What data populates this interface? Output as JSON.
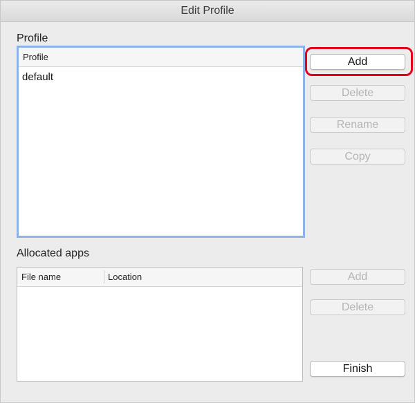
{
  "window": {
    "title": "Edit Profile"
  },
  "profile_section": {
    "label": "Profile",
    "column_header": "Profile",
    "rows": [
      "default"
    ]
  },
  "profile_buttons": {
    "add": "Add",
    "delete": "Delete",
    "rename": "Rename",
    "copy": "Copy"
  },
  "apps_section": {
    "label": "Allocated apps",
    "columns": [
      "File name",
      "Location"
    ],
    "rows": []
  },
  "apps_buttons": {
    "add": "Add",
    "delete": "Delete",
    "finish": "Finish"
  },
  "colors": {
    "highlight": "#e5001b",
    "focus_ring": "#8cb2ea"
  }
}
